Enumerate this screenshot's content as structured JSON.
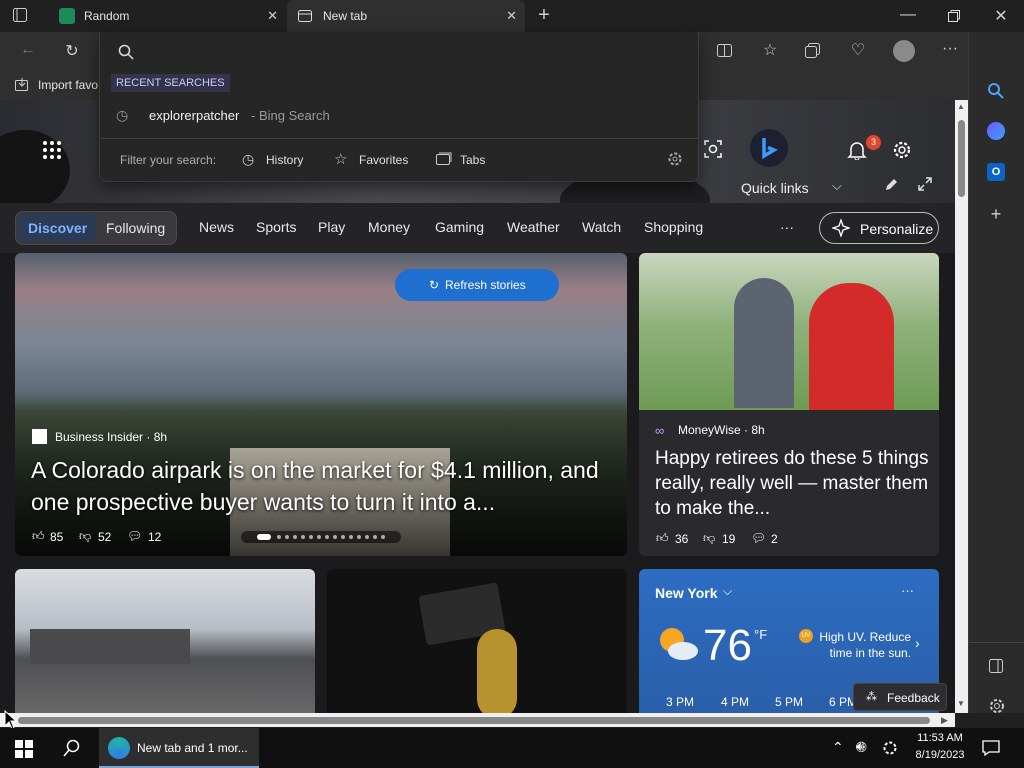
{
  "tabs": [
    {
      "title": "Random"
    },
    {
      "title": "New tab"
    }
  ],
  "favorites_bar": {
    "import_label": "Import favo"
  },
  "omnibox": {
    "recent_heading": "RECENT SEARCHES",
    "recent_item": {
      "query": "explorerpatcher",
      "suffix": " - Bing Search"
    },
    "filter_label": "Filter your search:",
    "filters": [
      "History",
      "Favorites",
      "Tabs"
    ]
  },
  "hero": {
    "quick_links": "Quick links",
    "notifications_count": "3"
  },
  "nav": {
    "pills": [
      "Discover",
      "Following"
    ],
    "items": [
      "News",
      "Sports",
      "Play",
      "Money",
      "Gaming",
      "Weather",
      "Watch",
      "Shopping"
    ],
    "more": "···",
    "personalize": "Personalize"
  },
  "feed": {
    "refresh_label": "Refresh stories",
    "main_story": {
      "source": "Business Insider · 8h",
      "headline": "A Colorado airpark is on the market for $4.1 million, and one prospective buyer wants to turn it into a...",
      "likes": "85",
      "dislikes": "52",
      "comments": "12"
    },
    "side_story": {
      "source": "MoneyWise · 8h",
      "headline": "Happy retirees do these 5 things really, really well — master them to make the...",
      "likes": "36",
      "dislikes": "19",
      "comments": "2"
    },
    "weather": {
      "city": "New York",
      "temp": "76",
      "unit": "°F",
      "alert": "High UV. Reduce time in the sun.",
      "hours": [
        "3 PM",
        "4 PM",
        "5 PM",
        "6 PM"
      ],
      "more": "···"
    },
    "feedback": "Feedback"
  },
  "taskbar": {
    "app_label": "New tab and 1 mor...",
    "time": "11:53 AM",
    "date": "8/19/2023"
  },
  "colors": {
    "accent": "#0067c0",
    "link_blue": "#4aa3ff"
  }
}
